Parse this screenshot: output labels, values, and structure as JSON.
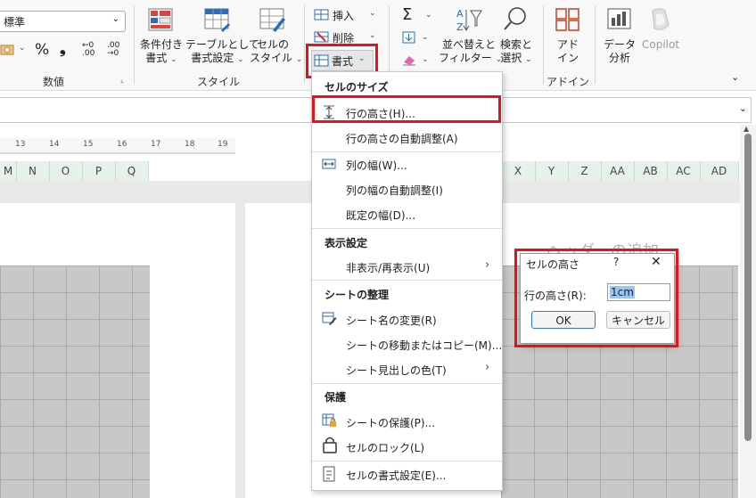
{
  "ribbon": {
    "number_format_value": "標準",
    "number_group_label": "数値",
    "percent_symbol": "%",
    "comma_symbol": "❟",
    "dec_increase_label": "←0 .00",
    "dec_decrease_label": ".00 →0",
    "style_group_label": "スタイル",
    "conditional_format_line1": "条件付き",
    "conditional_format_line2": "書式",
    "table_format_line1": "テーブルとして",
    "table_format_line2": "書式設定",
    "cell_style_line1": "セルの",
    "cell_style_line2": "スタイル",
    "insert_label": "挿入",
    "delete_label": "削除",
    "format_label": "書式",
    "sort_filter_line1": "並べ替えと",
    "sort_filter_line2": "フィルター",
    "find_select_line1": "検索と",
    "find_select_line2": "選択",
    "addin_line1": "アド",
    "addin_line2": "イン",
    "addin_group_label": "アドイン",
    "data_analysis_line1": "データ",
    "data_analysis_line2": "分析",
    "copilot_label": "Copilot"
  },
  "ruler": {
    "ticks": [
      "13",
      "14",
      "15",
      "16",
      "17",
      "18",
      "19"
    ]
  },
  "columns_left": [
    "M",
    "N",
    "O",
    "P",
    "Q"
  ],
  "columns_right": [
    "X",
    "Y",
    "Z",
    "AA",
    "AB",
    "AC",
    "AD"
  ],
  "header_placeholder": "ヘッダーの追加",
  "menu": {
    "section_cell_size": "セルのサイズ",
    "row_height": "行の高さ(H)...",
    "row_autofit": "行の高さの自動調整(A)",
    "col_width": "列の幅(W)...",
    "col_autofit": "列の幅の自動調整(I)",
    "default_width": "既定の幅(D)...",
    "section_visibility": "表示設定",
    "hide_unhide": "非表示/再表示(U)",
    "section_organize": "シートの整理",
    "rename_sheet": "シート名の変更(R)",
    "move_copy_sheet": "シートの移動またはコピー(M)...",
    "tab_color": "シート見出しの色(T)",
    "section_protect": "保護",
    "protect_sheet": "シートの保護(P)...",
    "lock_cell": "セルのロック(L)",
    "format_cells": "セルの書式設定(E)..."
  },
  "dialog": {
    "title": "セルの高さ",
    "help": "?",
    "close": "✕",
    "field_label": "行の高さ(R):",
    "field_value": "1cm",
    "ok_label": "OK",
    "cancel_label": "キャンセル"
  },
  "colors": {
    "highlight": "#e8101a",
    "header_green": "#e6f2e9",
    "accent_green": "#1e7145"
  }
}
